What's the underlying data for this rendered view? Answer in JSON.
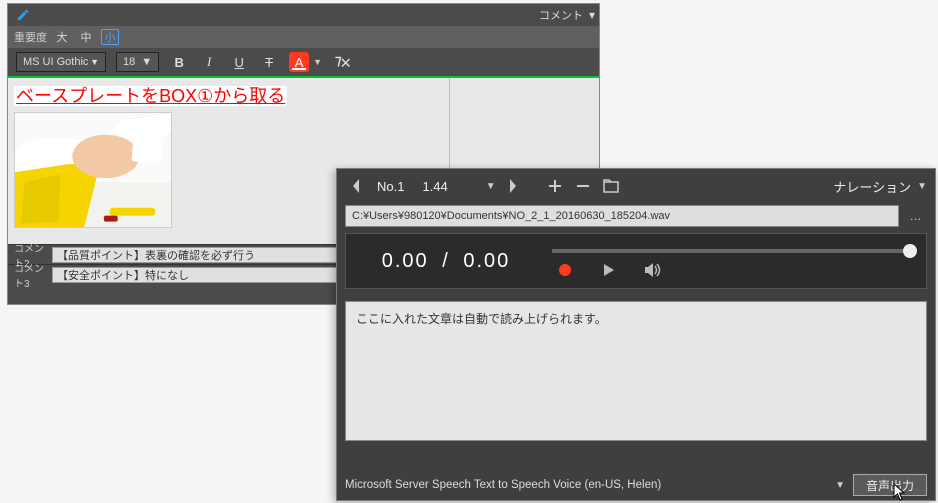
{
  "editor": {
    "titlebar": {
      "comment_label": "コメント"
    },
    "priority": {
      "label": "重要度",
      "high": "大",
      "mid": "中",
      "low": "小",
      "selected": "low"
    },
    "format": {
      "font_name": "MS UI Gothic",
      "font_size": "18",
      "bold": "B",
      "italic": "I",
      "underline": "U",
      "strike": "T",
      "highlight": "A"
    },
    "main_text": "ベースプレートをBOX①から取る",
    "comments": [
      {
        "label": "コメント2",
        "value": "【品質ポイント】表裏の確認を必ず行う"
      },
      {
        "label": "コメント3",
        "value": "【安全ポイント】特になし"
      }
    ]
  },
  "narration": {
    "titlebar": {
      "item_no": "No.1",
      "duration": "1.44",
      "label": "ナレーション"
    },
    "file_path": "C:¥Users¥980120¥Documents¥NO_2_1_20160630_185204.wav",
    "player": {
      "current": "0.00",
      "sep": "/",
      "total": "0.00"
    },
    "textarea_text": "ここに入れた文章は自動で読み上げられます。",
    "footer": {
      "voice_name": "Microsoft Server Speech Text to Speech Voice (en-US, Helen)",
      "output_button": "音声出力"
    }
  }
}
